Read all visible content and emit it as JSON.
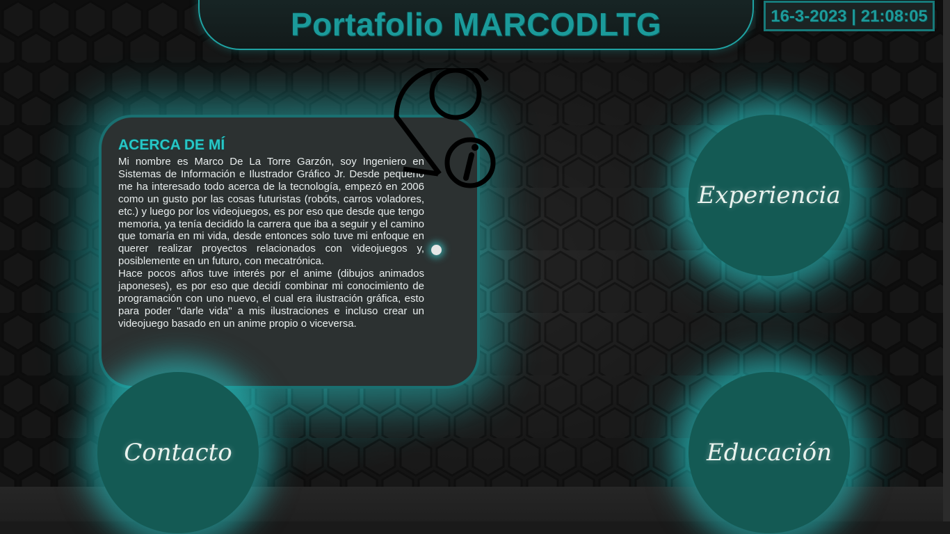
{
  "header": {
    "title": "Portafolio MARCODLTG"
  },
  "clock": {
    "datetime": "16-3-2023 | 21:08:05"
  },
  "about": {
    "heading": "ACERCA DE MÍ",
    "paragraph_1": "Mi nombre es Marco De La Torre Garzón, soy Ingeniero en Sistemas de Información e Ilustrador Gráfico Jr. Desde pequeño me ha interesado todo acerca de la tecnología, empezó en 2006 como un gusto por las cosas futuristas (robóts, carros voladores, etc.) y luego por los videojuegos, es por eso que desde que tengo memoria, ya tenía decidido la carrera que iba a seguir y el camino que tomaría en mi vida, desde entonces solo tuve mi enfoque en querer realizar proyectos relacionados con videojuegos y, posiblemente en un futuro, con mecatrónica.",
    "paragraph_2": "Hace pocos años tuve interés por el anime (dibujos animados japoneses), es por eso que decidí combinar mi conocimiento de programación con uno nuevo, el cual era ilustración gráfica, esto para poder \"darle vida\" a mis ilustraciones e incluso crear un videojuego basado en un anime propio o viceversa."
  },
  "nav": {
    "experiencia": "Experiencia",
    "contacto": "Contacto",
    "educacion": "Educación"
  },
  "icons": {
    "about": "user-info-icon"
  },
  "colors": {
    "accent": "#1fa3a3",
    "glow": "#28d2d2",
    "circle": "#145a54",
    "card": "#2c3131"
  }
}
